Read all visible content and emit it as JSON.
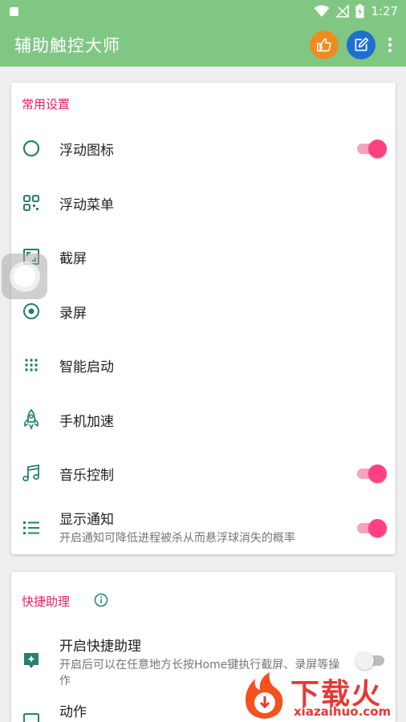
{
  "status_bar": {
    "time": "1:27"
  },
  "app_bar": {
    "title": "辅助触控大师"
  },
  "colors": {
    "app_bar": "#81c784",
    "accent": "#e91e63",
    "switch_on": "#ff4081",
    "icon_teal": "#26806f",
    "like_button": "#ef8c1f",
    "edit_button": "#1f6fcf"
  },
  "common_settings": {
    "title": "常用设置",
    "items": [
      {
        "label": "浮动图标",
        "icon": "circle-outline-icon",
        "switch": true
      },
      {
        "label": "浮动菜单",
        "icon": "grid-menu-icon"
      },
      {
        "label": "截屏",
        "icon": "screenshot-icon"
      },
      {
        "label": "录屏",
        "icon": "record-icon"
      },
      {
        "label": "智能启动",
        "icon": "apps-grid-icon"
      },
      {
        "label": "手机加速",
        "icon": "rocket-icon"
      },
      {
        "label": "音乐控制",
        "icon": "music-note-icon",
        "switch": true
      },
      {
        "label": "显示通知",
        "sub": "开启通知可降低进程被杀从而悬浮球消失的概率",
        "icon": "list-icon",
        "switch": true
      }
    ]
  },
  "quick_assistant": {
    "title": "快捷助理",
    "items": [
      {
        "label": "开启快捷助理",
        "sub": "开启后可以在任意地方长按Home键执行截屏、录屏等操作",
        "icon": "assistant-icon",
        "switch": false
      },
      {
        "label": "动作",
        "icon": "action-icon"
      }
    ]
  },
  "watermark": {
    "text": "下载火",
    "url": "xiazaihuo.com"
  }
}
